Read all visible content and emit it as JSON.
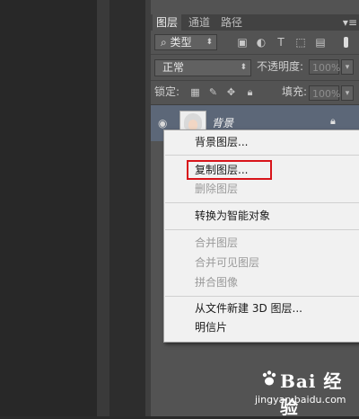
{
  "layers_panel": {
    "tabs": [
      "图层",
      "通道",
      "路径"
    ],
    "filter": {
      "label": "类型",
      "icon": "search-icon"
    },
    "blend_mode": "正常",
    "opacity_label": "不透明度:",
    "opacity_value": "100%",
    "lock_label": "锁定:",
    "fill_label": "填充:",
    "fill_value": "100%",
    "layer": {
      "name": "背景"
    }
  },
  "context_menu": {
    "items": [
      {
        "label": "背景图层...",
        "enabled": true
      },
      {
        "label": "复制图层...",
        "enabled": true,
        "highlighted": true
      },
      {
        "label": "删除图层",
        "enabled": false
      },
      {
        "label": "转换为智能对象",
        "enabled": true
      },
      {
        "label": "合并图层",
        "enabled": false
      },
      {
        "label": "合并可见图层",
        "enabled": false
      },
      {
        "label": "拼合图像",
        "enabled": false
      },
      {
        "label": "从文件新建 3D 图层...",
        "enabled": true
      },
      {
        "label": "明信片",
        "enabled": true
      }
    ],
    "highlight_color": "#d8141a"
  },
  "watermark": {
    "logo_text": "Bai 经验",
    "url": "jingyan.baidu.com"
  }
}
